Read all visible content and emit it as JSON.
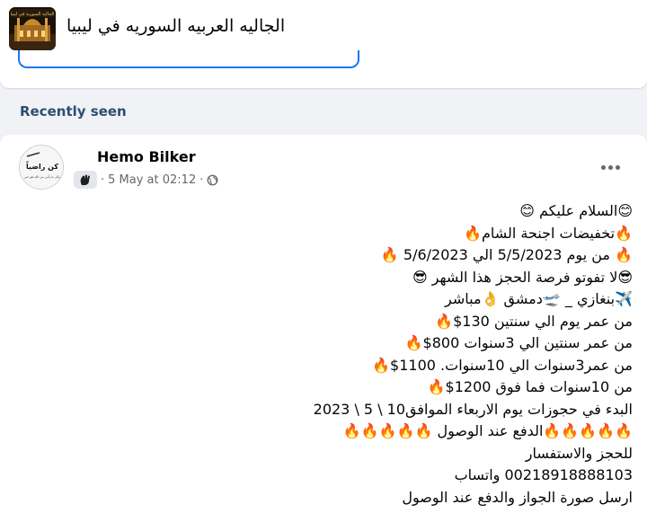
{
  "group": {
    "name": "الجاليه العربيه السوريه في ليبيا",
    "thumb_text": "الجالية السورية في ليبيا"
  },
  "section": {
    "label": "Recently seen"
  },
  "post": {
    "author": "Hemo Bilker",
    "date": "5 May at 02:12",
    "separator": "·",
    "avatar_text": "كن راضياً",
    "avatar_subtext": "وكل ما يأتي من الله هو خير",
    "lines": [
      "😊السلام عليكم 😊",
      "🔥تخفيضات اجنحة الشام🔥",
      "🔥 من يوم 5/5/2023  الي  5/6/2023 🔥",
      "😎لا تفوتو فرصة الحجز هذا الشهر 😎",
      "✈️بنغازي _ 🛫دمشق 👌مباشر",
      "من عمر يوم الي سنتين      130$🔥",
      "من عمر سنتين الي 3سنوات      800$🔥",
      "من عمر3سنوات الي 10سنوات.   1100$🔥",
      "من 10سنوات فما فوق       1200$🔥",
      "البدء في حجوزات يوم الاربعاء  الموافق10 \\ 5 \\ 2023",
      "🔥🔥🔥🔥🔥الدفع عند الوصول 🔥🔥🔥🔥🔥",
      "للحجز والاستفسار",
      "00218918888103  واتساب",
      "ارسل صورة الجواز والدفع عند الوصول"
    ]
  },
  "colors": {
    "accent": "#1877f2",
    "section_label": "#2e4d73",
    "meta": "#65676b"
  }
}
